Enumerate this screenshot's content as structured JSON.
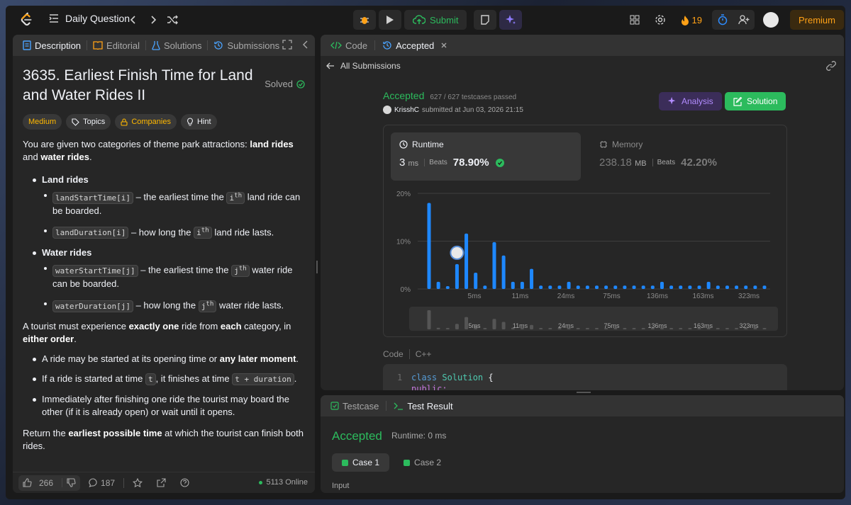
{
  "topbar": {
    "daily_label": "Daily Question",
    "submit_label": "Submit",
    "streak": "19",
    "premium_label": "Premium"
  },
  "left_tabs": [
    "Description",
    "Editorial",
    "Solutions",
    "Submissions"
  ],
  "problem": {
    "title": "3635. Earliest Finish Time for Land and Water Rides II",
    "status": "Solved",
    "tags": [
      "Medium",
      "Topics",
      "Companies",
      "Hint"
    ],
    "intro_pre": "You are given two categories of theme park attractions: ",
    "intro_b1": "land rides",
    "intro_mid": " and ",
    "intro_b2": "water rides",
    "intro_end": ".",
    "land_heading": "Land rides",
    "land1_code": "landStartTime[i]",
    "land1_pre": " – the earliest time the ",
    "land1_sup": "i",
    "land1_sup2": "th",
    "land1_post": " land ride can be boarded.",
    "land2_code": "landDuration[i]",
    "land2_pre": " – how long the ",
    "land2_post": " land ride lasts.",
    "water_heading": "Water rides",
    "water1_code": "waterStartTime[j]",
    "water1_pre": " – the earliest time the ",
    "water_sup": "j",
    "water1_post": " water ride can be boarded.",
    "water2_code": "waterDuration[j]",
    "water2_pre": " – how long the ",
    "water2_post": " water ride lasts.",
    "p2_a": "A tourist must experience ",
    "p2_b": "exactly one",
    "p2_c": " ride from ",
    "p2_d": "each",
    "p2_e": " category, in ",
    "p2_f": "either order",
    "p2_g": ".",
    "rule1_a": "A ride may be started at its opening time or ",
    "rule1_b": "any later moment",
    "rule1_c": ".",
    "rule2_a": "If a ride is started at time ",
    "rule2_code1": "t",
    "rule2_b": ", it finishes at time ",
    "rule2_code2": "t + duration",
    "rule2_c": ".",
    "rule3": "Immediately after finishing one ride the tourist may board the other (if it is already open) or wait until it opens.",
    "final_a": "Return the ",
    "final_b": "earliest possible time",
    "final_c": " at which the tourist can finish both rides."
  },
  "footer": {
    "likes": "266",
    "comments": "187",
    "online": "5113 Online"
  },
  "right_tabs": {
    "code": "Code",
    "accepted": "Accepted"
  },
  "submission": {
    "back_label": "All Submissions",
    "status": "Accepted",
    "testcases": "627 / 627 testcases passed",
    "user": "KrisshC",
    "submitted": "submitted at Jun 03, 2026 21:15",
    "analysis_label": "Analysis",
    "solution_label": "Solution",
    "runtime_label": "Runtime",
    "runtime_value": "3",
    "runtime_unit": "ms",
    "beats_label": "Beats",
    "runtime_beats": "78.90%",
    "memory_label": "Memory",
    "memory_value": "238.18",
    "memory_unit": "MB",
    "memory_beats": "42.20%",
    "code_label": "Code",
    "lang": "C++",
    "code_line1_num": "1",
    "code_kw": "class",
    "code_cls": "Solution",
    "code_brace": "{",
    "code_line2": "public:"
  },
  "chart_data": {
    "type": "bar",
    "ylabel": "",
    "xlabel": "",
    "ylim": [
      0,
      20
    ],
    "y_ticks": [
      "20%",
      "10%",
      "0%"
    ],
    "x_tick_labels": [
      "5ms",
      "11ms",
      "24ms",
      "75ms",
      "136ms",
      "163ms",
      "323ms"
    ],
    "values": [
      18,
      1.5,
      0.6,
      5.2,
      11.6,
      3.4,
      0.7,
      9.8,
      7.0,
      1.5,
      1.5,
      4.2,
      0.7,
      0.7,
      0.7,
      1.5,
      0.7,
      0.7,
      0.7,
      0.7,
      0.7,
      0.7,
      0.7,
      0.7,
      0.7,
      1.5,
      0.7,
      0.7,
      0.7,
      0.7,
      1.5,
      0.7,
      0.7,
      0.7,
      0.7,
      0.7,
      0.7
    ],
    "highlight_index": 3,
    "color": "#1e88ff"
  },
  "bottom": {
    "tab_testcase": "Testcase",
    "tab_result": "Test Result",
    "status": "Accepted",
    "runtime": "Runtime: 0 ms",
    "case1": "Case 1",
    "case2": "Case 2",
    "input_label": "Input"
  },
  "colors": {
    "accent_green": "#2cbb5d",
    "brand_orange": "#ffa116",
    "bar_blue": "#1e88ff"
  }
}
